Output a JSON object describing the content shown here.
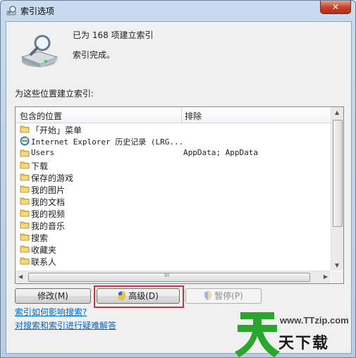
{
  "window": {
    "title": "索引选项",
    "close_label": "✕"
  },
  "summary": {
    "count_text": "已为 168 项建立索引",
    "status_text": "索引完成。"
  },
  "locations": {
    "label": "为这些位置建立索引:",
    "columns": {
      "included": "包含的位置",
      "excluded": "排除"
    },
    "rows": [
      {
        "name": "「开始」菜单",
        "excluded": "",
        "icon": "folder-icon"
      },
      {
        "name": "Internet Explorer 历史记录 (LRG...",
        "excluded": "",
        "icon": "ie-icon"
      },
      {
        "name": "Users",
        "excluded": "AppData; AppData",
        "icon": "folder-icon"
      },
      {
        "name": "下载",
        "excluded": "",
        "icon": "folder-icon"
      },
      {
        "name": "保存的游戏",
        "excluded": "",
        "icon": "folder-icon"
      },
      {
        "name": "我的图片",
        "excluded": "",
        "icon": "folder-icon"
      },
      {
        "name": "我的文档",
        "excluded": "",
        "icon": "folder-icon"
      },
      {
        "name": "我的视频",
        "excluded": "",
        "icon": "folder-icon"
      },
      {
        "name": "我的音乐",
        "excluded": "",
        "icon": "folder-icon"
      },
      {
        "name": "搜索",
        "excluded": "",
        "icon": "folder-icon"
      },
      {
        "name": "收藏夹",
        "excluded": "",
        "icon": "folder-icon"
      },
      {
        "name": "联系人",
        "excluded": "",
        "icon": "folder-icon"
      }
    ],
    "hscroll_mark": "III"
  },
  "buttons": {
    "modify": "修改(M)",
    "advanced": "高级(D)",
    "pause": "暂停(P)"
  },
  "links": {
    "how_affects": "索引如何影响搜索?",
    "troubleshoot": "对搜索和索引进行疑难解答"
  },
  "watermark": {
    "url": "www.TTzip.com",
    "chars": "天下载"
  },
  "colors": {
    "link": "#0066cc",
    "highlight": "#d0303a",
    "close": "#c7442b",
    "watermark": "#2aa52e"
  }
}
